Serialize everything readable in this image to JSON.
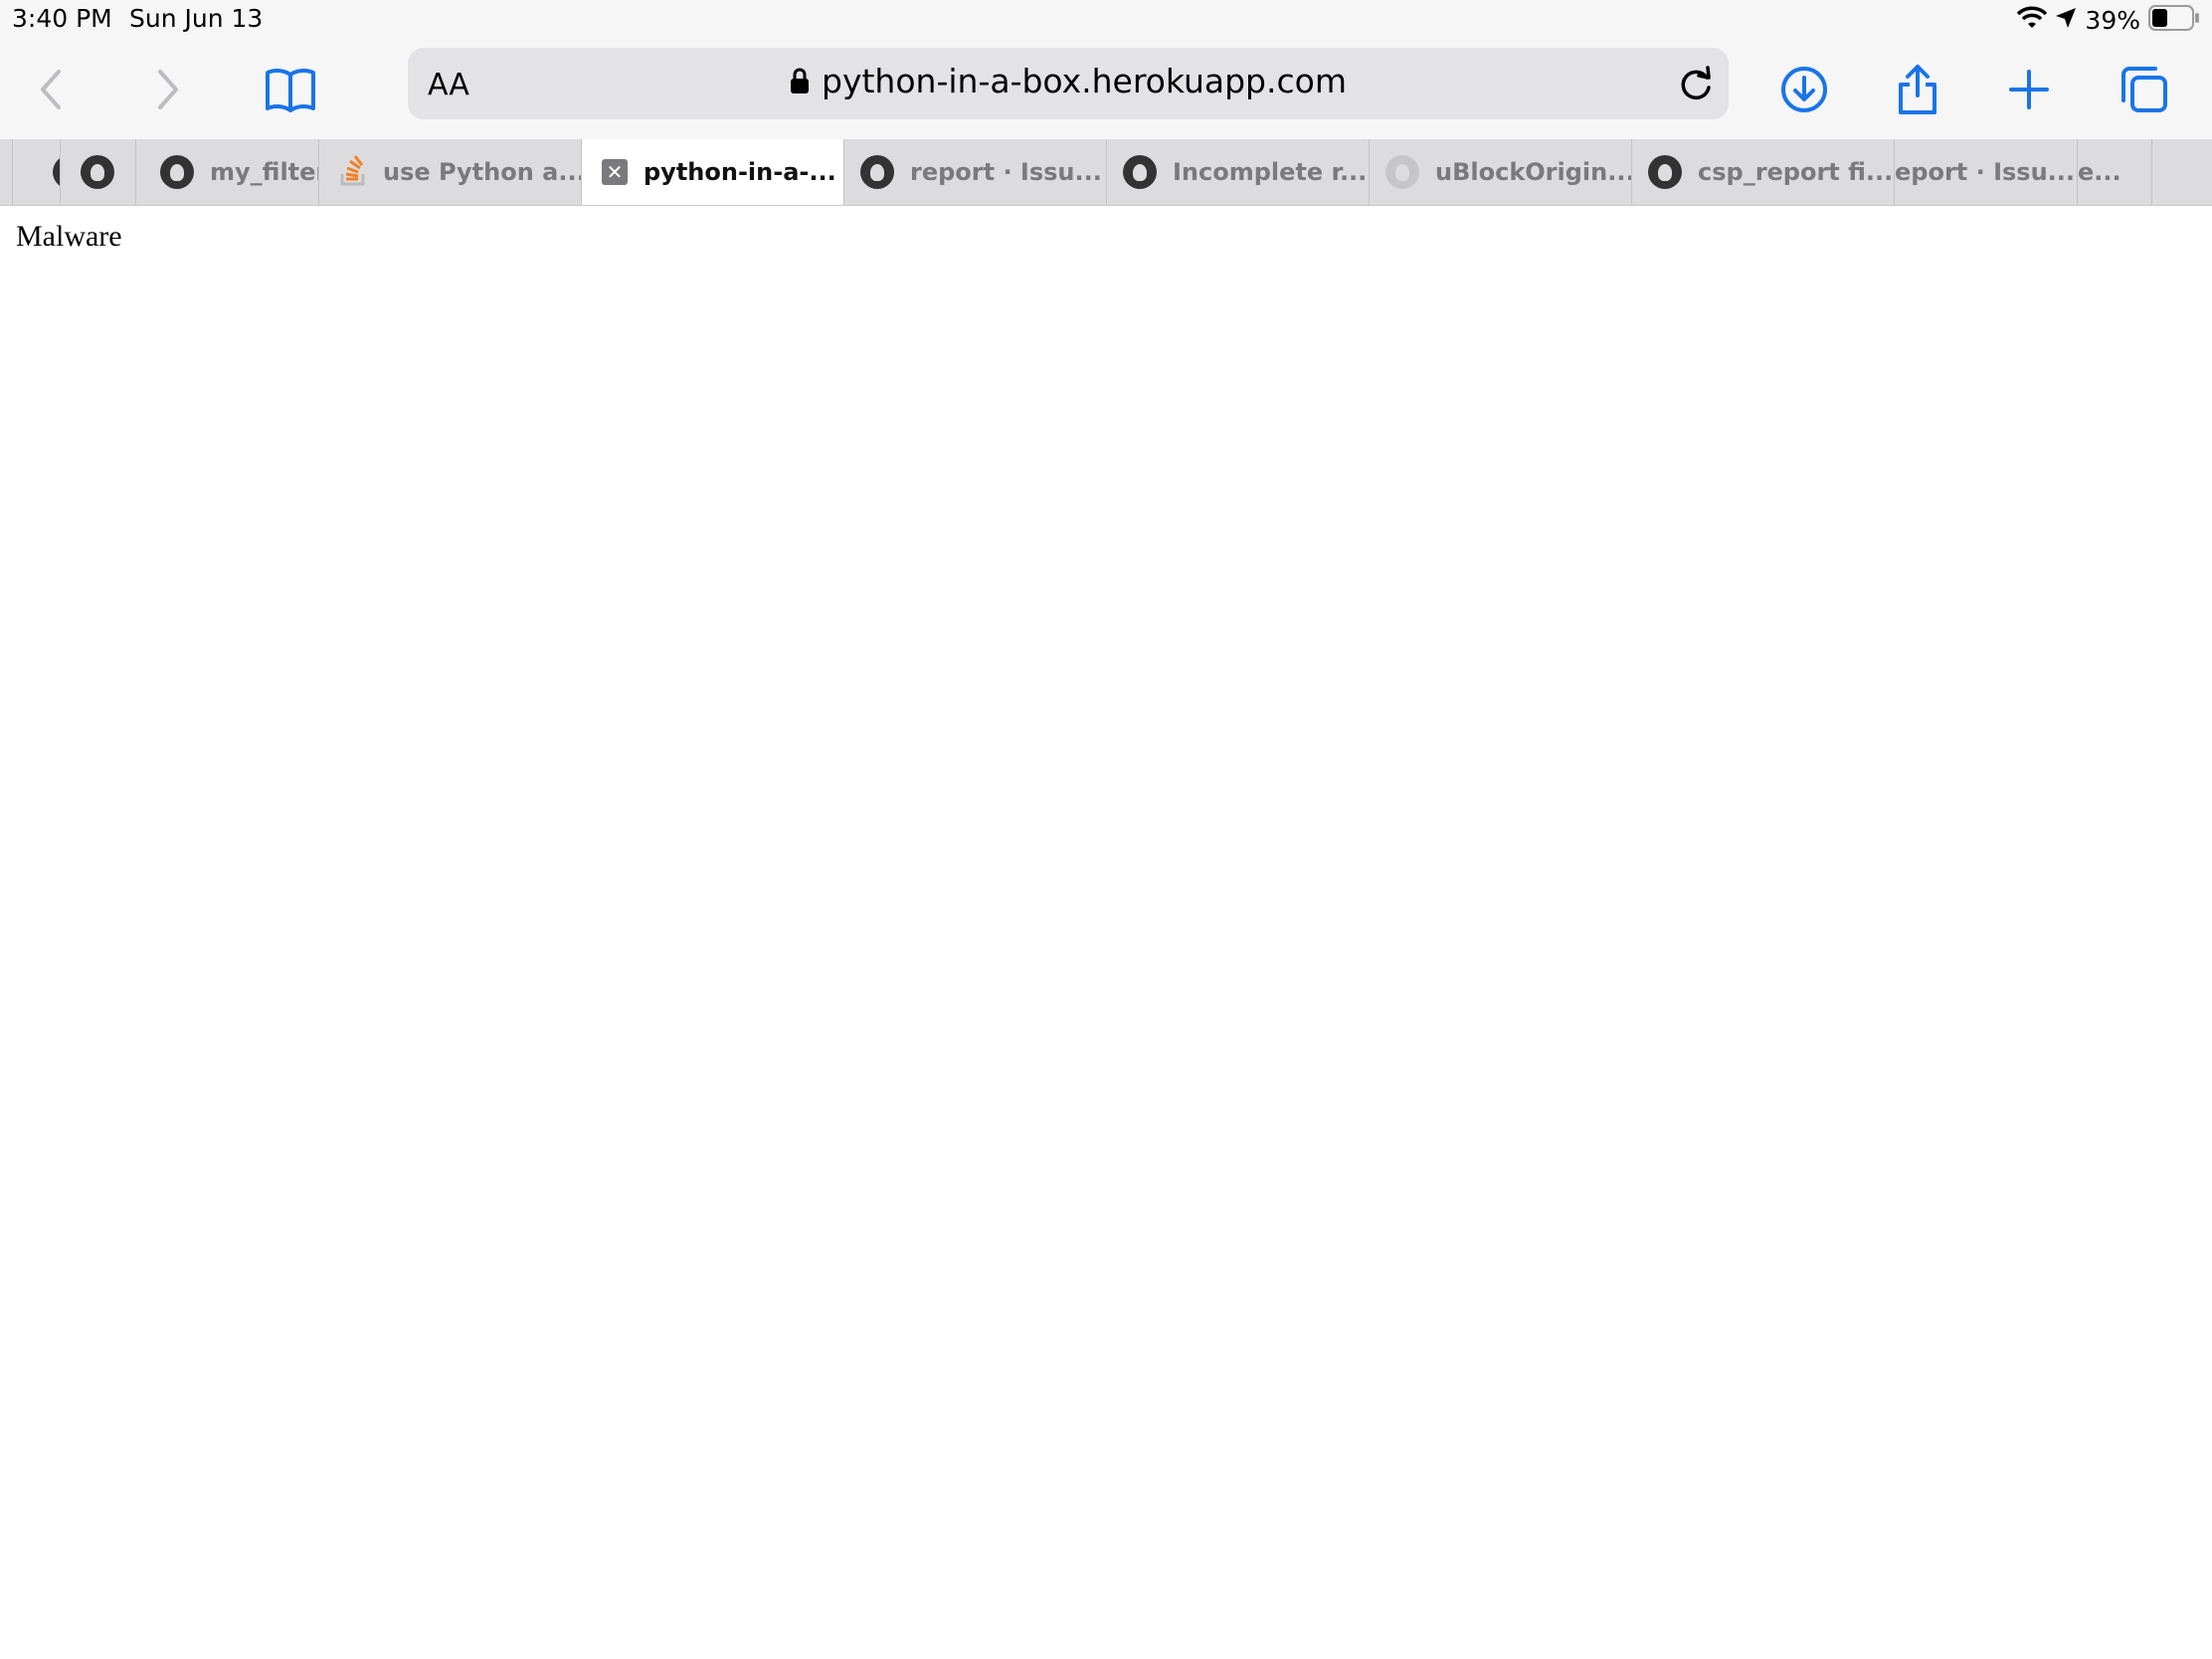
{
  "status_bar": {
    "time": "3:40 PM",
    "date": "Sun Jun 13",
    "battery_percent": "39%",
    "battery_level": 0.39,
    "icons": [
      "wifi-icon",
      "location-icon",
      "battery-icon"
    ]
  },
  "toolbar": {
    "icons": [
      "back-icon",
      "forward-icon",
      "bookmarks-icon",
      "download-icon",
      "share-icon",
      "new-tab-icon",
      "tabs-overview-icon"
    ],
    "accent_color": "#1a74e8"
  },
  "address_bar": {
    "reader_label": "AA",
    "url": "python-in-a-box.herokuapp.com"
  },
  "tabs": [
    {
      "label": "",
      "icon": "github-icon"
    },
    {
      "label": "my_filters",
      "icon": "github-icon"
    },
    {
      "label": "use Python a...",
      "icon": "stackoverflow-icon"
    },
    {
      "label": "python-in-a-...",
      "icon": "close-icon",
      "active": true
    },
    {
      "label": "report · Issu...",
      "icon": "github-icon"
    },
    {
      "label": "Incomplete r...",
      "icon": "github-icon"
    },
    {
      "label": "uBlockOrigin...",
      "icon": "github-icon"
    },
    {
      "label": "csp_report fi...",
      "icon": "github-icon"
    },
    {
      "label": "eport · Issu...",
      "icon": ""
    },
    {
      "label": "e...",
      "icon": ""
    }
  ],
  "page": {
    "body_text": "Malware"
  }
}
